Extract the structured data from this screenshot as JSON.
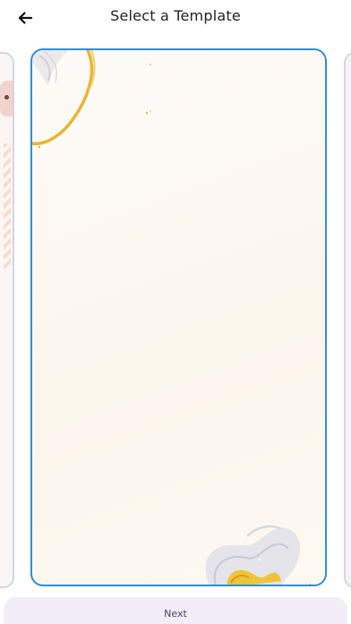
{
  "header": {
    "title": "Select a Template",
    "back_icon": "arrow-left-icon"
  },
  "carousel": {
    "selected_border_color": "#2f8fd6",
    "cards": [
      {
        "position": "previous",
        "icon": "template-thumbnail"
      },
      {
        "position": "selected",
        "icon": "template-thumbnail"
      },
      {
        "position": "next",
        "icon": "template-thumbnail"
      }
    ]
  },
  "footer": {
    "next_label": "Next"
  }
}
